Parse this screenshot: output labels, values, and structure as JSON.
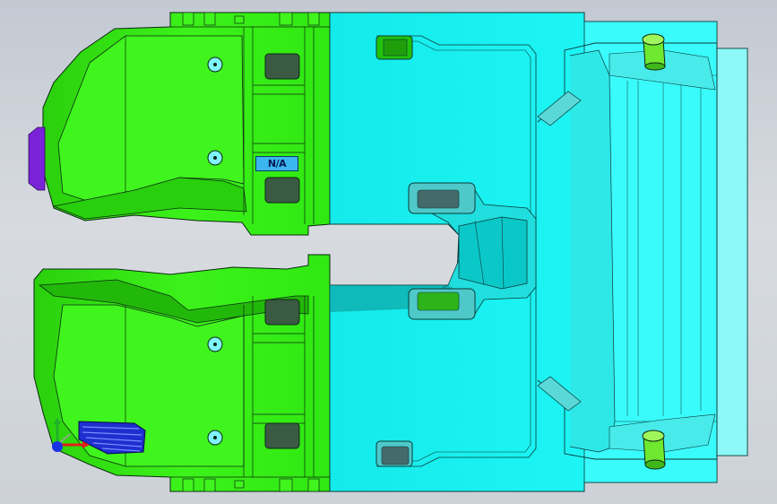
{
  "viewport": {
    "background": "#cdd2d8"
  },
  "model": {
    "part_label": "N/A",
    "colors": {
      "green_face": "#33ee11",
      "green_shade": "#22c20a",
      "cyan_face": "#16f4f4",
      "cyan_shade": "#0bc8c8",
      "pale_cyan": "#8ef8f8",
      "edge": "#0c2a12",
      "purple_face": "#7a22d8",
      "blue_hatch": "#1e2fd0"
    }
  },
  "triad": {
    "x_axis_color": "#e0201a",
    "y_axis_color": "#22b02a",
    "z_axis_color": "#1a32e6"
  }
}
